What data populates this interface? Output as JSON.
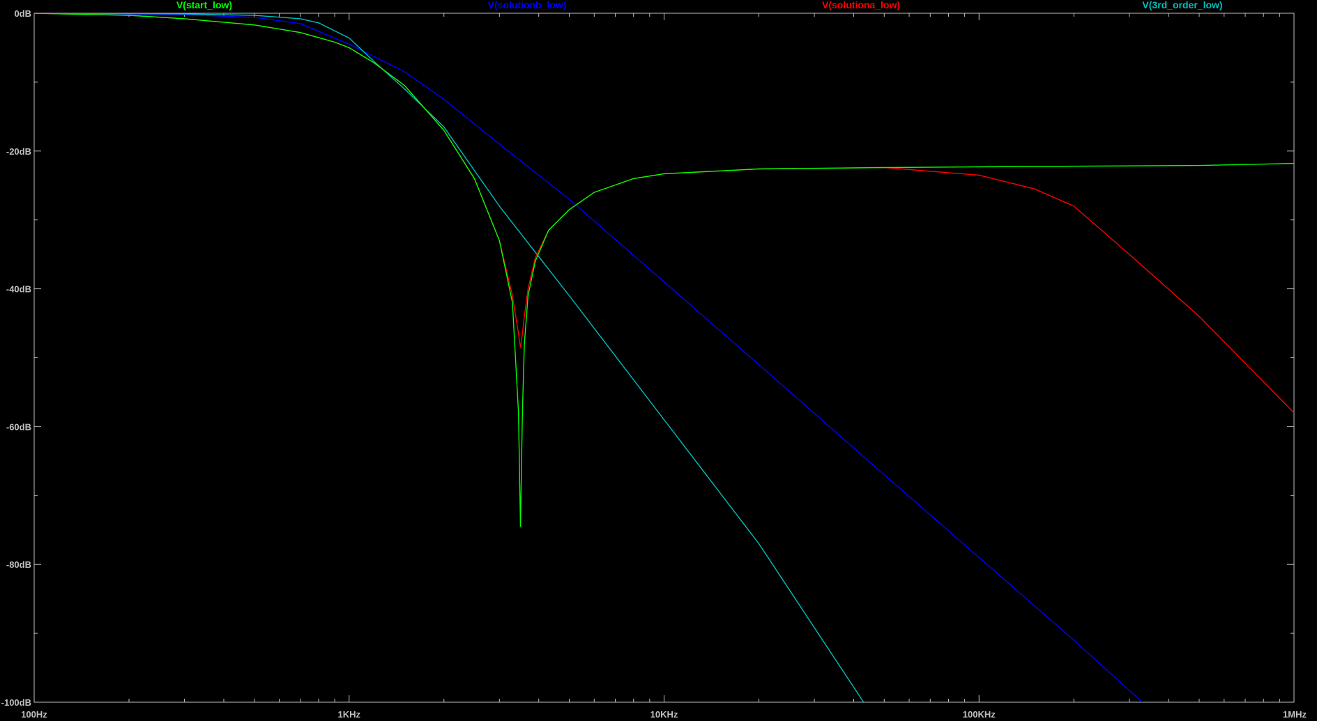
{
  "chart_data": {
    "type": "line",
    "title": "",
    "xlabel": "",
    "ylabel": "",
    "x_scale": "log",
    "xlim": [
      100,
      1000000
    ],
    "ylim": [
      -100,
      0
    ],
    "x_ticks": [
      {
        "value": 100,
        "label": "100Hz"
      },
      {
        "value": 1000,
        "label": "1KHz"
      },
      {
        "value": 10000,
        "label": "10KHz"
      },
      {
        "value": 100000,
        "label": "100KHz"
      },
      {
        "value": 1000000,
        "label": "1MHz"
      }
    ],
    "y_ticks": [
      {
        "value": 0,
        "label": "0dB"
      },
      {
        "value": -20,
        "label": "-20dB"
      },
      {
        "value": -40,
        "label": "-40dB"
      },
      {
        "value": -60,
        "label": "-60dB"
      },
      {
        "value": -80,
        "label": "-80dB"
      },
      {
        "value": -100,
        "label": "-100dB"
      }
    ],
    "grid": false,
    "legend_position": "top",
    "background_color": "#000000",
    "axis_color": "#c0c0c0",
    "series": [
      {
        "name": "V(start_low)",
        "color": "#00ff00",
        "x": [
          100,
          200,
          300,
          500,
          700,
          900,
          1000,
          1200,
          1500,
          2000,
          2500,
          3000,
          3300,
          3450,
          3500,
          3550,
          3600,
          3700,
          3900,
          4300,
          5000,
          6000,
          8000,
          10000,
          20000,
          50000,
          100000,
          200000,
          500000,
          1000000
        ],
        "y": [
          0,
          -0.3,
          -0.8,
          -1.7,
          -2.8,
          -4.2,
          -5.0,
          -7.2,
          -10.5,
          -17.0,
          -24.0,
          -33.0,
          -42.0,
          -58.0,
          -74.5,
          -58.0,
          -48.0,
          -41.0,
          -36.0,
          -31.5,
          -28.5,
          -26.0,
          -24.0,
          -23.3,
          -22.6,
          -22.4,
          -22.3,
          -22.2,
          -22.1,
          -21.8
        ]
      },
      {
        "name": "V(solutionb_low)",
        "color": "#0000ff",
        "x": [
          100,
          300,
          500,
          700,
          1000,
          1500,
          2000,
          3000,
          5000,
          10000,
          20000,
          50000,
          100000,
          200000,
          330000
        ],
        "y": [
          0,
          -0.2,
          -0.6,
          -1.5,
          -4.5,
          -8.5,
          -12.5,
          -19.0,
          -27.0,
          -39.0,
          -51.0,
          -67.0,
          -79.0,
          -91.0,
          -100.0
        ]
      },
      {
        "name": "V(solutiona_low)",
        "color": "#ff0000",
        "x": [
          100,
          200,
          300,
          500,
          700,
          900,
          1000,
          1200,
          1500,
          2000,
          2500,
          3000,
          3300,
          3450,
          3500,
          3550,
          3600,
          3700,
          3900,
          4300,
          5000,
          6000,
          8000,
          10000,
          20000,
          50000,
          100000,
          150000,
          200000,
          300000,
          500000,
          1000000
        ],
        "y": [
          0,
          -0.3,
          -0.8,
          -1.7,
          -2.8,
          -4.2,
          -5.0,
          -7.2,
          -10.5,
          -17.0,
          -24.0,
          -33.0,
          -41.0,
          -46.5,
          -48.5,
          -46.5,
          -44.0,
          -40.0,
          -35.5,
          -31.5,
          -28.5,
          -26.0,
          -24.0,
          -23.3,
          -22.6,
          -22.4,
          -23.5,
          -25.5,
          -28.0,
          -35.0,
          -44.0,
          -58.0
        ]
      },
      {
        "name": "V(3rd_order_low)",
        "color": "#00bfbf",
        "x": [
          100,
          300,
          500,
          700,
          800,
          1000,
          1200,
          1500,
          2000,
          3000,
          5000,
          10000,
          20000,
          43000
        ],
        "y": [
          0,
          -0.1,
          -0.3,
          -0.8,
          -1.4,
          -3.6,
          -7.0,
          -11.0,
          -16.5,
          -28.0,
          -41.0,
          -59.0,
          -77.0,
          -100.0
        ]
      }
    ]
  }
}
